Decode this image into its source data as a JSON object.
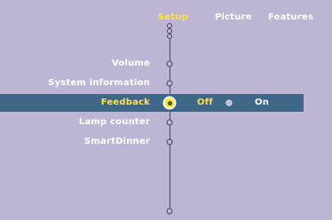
{
  "menu_bar": {
    "tabs": [
      {
        "label": "Setup",
        "active": true
      },
      {
        "label": "Picture",
        "active": false
      },
      {
        "label": "Features",
        "active": false
      }
    ]
  },
  "setup_menu": {
    "items": [
      {
        "label": "Volume",
        "selected": false
      },
      {
        "label": "System information",
        "selected": false
      },
      {
        "label": "Feedback",
        "selected": true
      },
      {
        "label": "Lamp counter",
        "selected": false
      },
      {
        "label": "SmartDinner",
        "selected": false
      }
    ]
  },
  "feedback_options": {
    "current": "Off",
    "alternative": "On"
  },
  "colors": {
    "background": "#beb4d4",
    "highlight": "#3f6787",
    "active_text": "#ffe43c",
    "text": "#ffffff"
  }
}
